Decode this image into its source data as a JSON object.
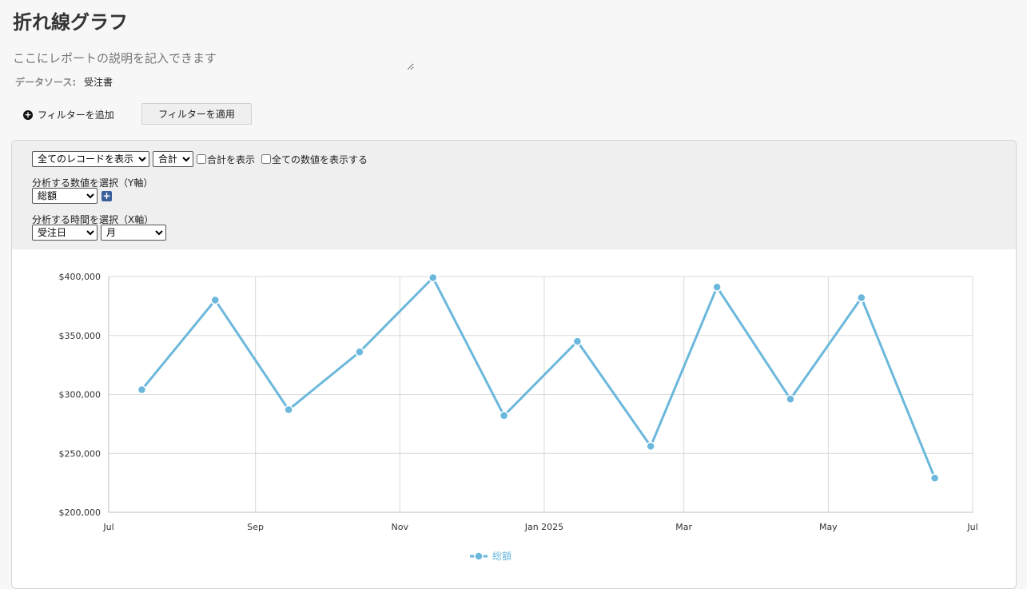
{
  "page": {
    "title": "折れ線グラフ",
    "description_placeholder": "ここにレポートの説明を記入できます",
    "datasource_label": "データソース:",
    "datasource_value": "受注書"
  },
  "filters": {
    "add_label": "フィルターを追加",
    "apply_label": "フィルターを適用"
  },
  "controls": {
    "records_select": "全てのレコードを表示",
    "aggregate_select": "合計",
    "show_total_label": "合計を表示",
    "show_all_values_label": "全ての数値を表示する",
    "y_label": "分析する数値を選択（Y軸）",
    "y_field": "総額",
    "x_label": "分析する時間を選択（X軸）",
    "x_field": "受注日",
    "x_unit": "月"
  },
  "colors": {
    "series": "#6bb8dc",
    "grid": "#d9d9d9"
  },
  "chart_data": {
    "type": "line",
    "x": [
      "2024-07-15",
      "2024-08-15",
      "2024-09-15",
      "2024-10-15",
      "2024-11-15",
      "2024-12-15",
      "2025-01-15",
      "2025-02-15",
      "2025-03-15",
      "2025-04-15",
      "2025-05-15",
      "2025-06-15"
    ],
    "series": [
      {
        "name": "総額",
        "values": [
          304000,
          380000,
          287000,
          336000,
          399000,
          282000,
          345000,
          256000,
          391000,
          296000,
          382000,
          229000
        ]
      }
    ],
    "ylim": [
      200000,
      400000
    ],
    "yticks": [
      200000,
      250000,
      300000,
      350000,
      400000
    ],
    "ytick_labels": [
      "$200,000",
      "$250,000",
      "$300,000",
      "$350,000",
      "$400,000"
    ],
    "xlim": [
      "2024-07-01",
      "2025-07-01"
    ],
    "xticks": [
      "2024-07-01",
      "2024-09-01",
      "2024-11-01",
      "2025-01-01",
      "2025-03-01",
      "2025-05-01",
      "2025-07-01"
    ],
    "xtick_labels": [
      "Jul",
      "Sep",
      "Nov",
      "Jan 2025",
      "Mar",
      "May",
      "Jul"
    ],
    "grid": true,
    "legend": "bottom-center"
  }
}
